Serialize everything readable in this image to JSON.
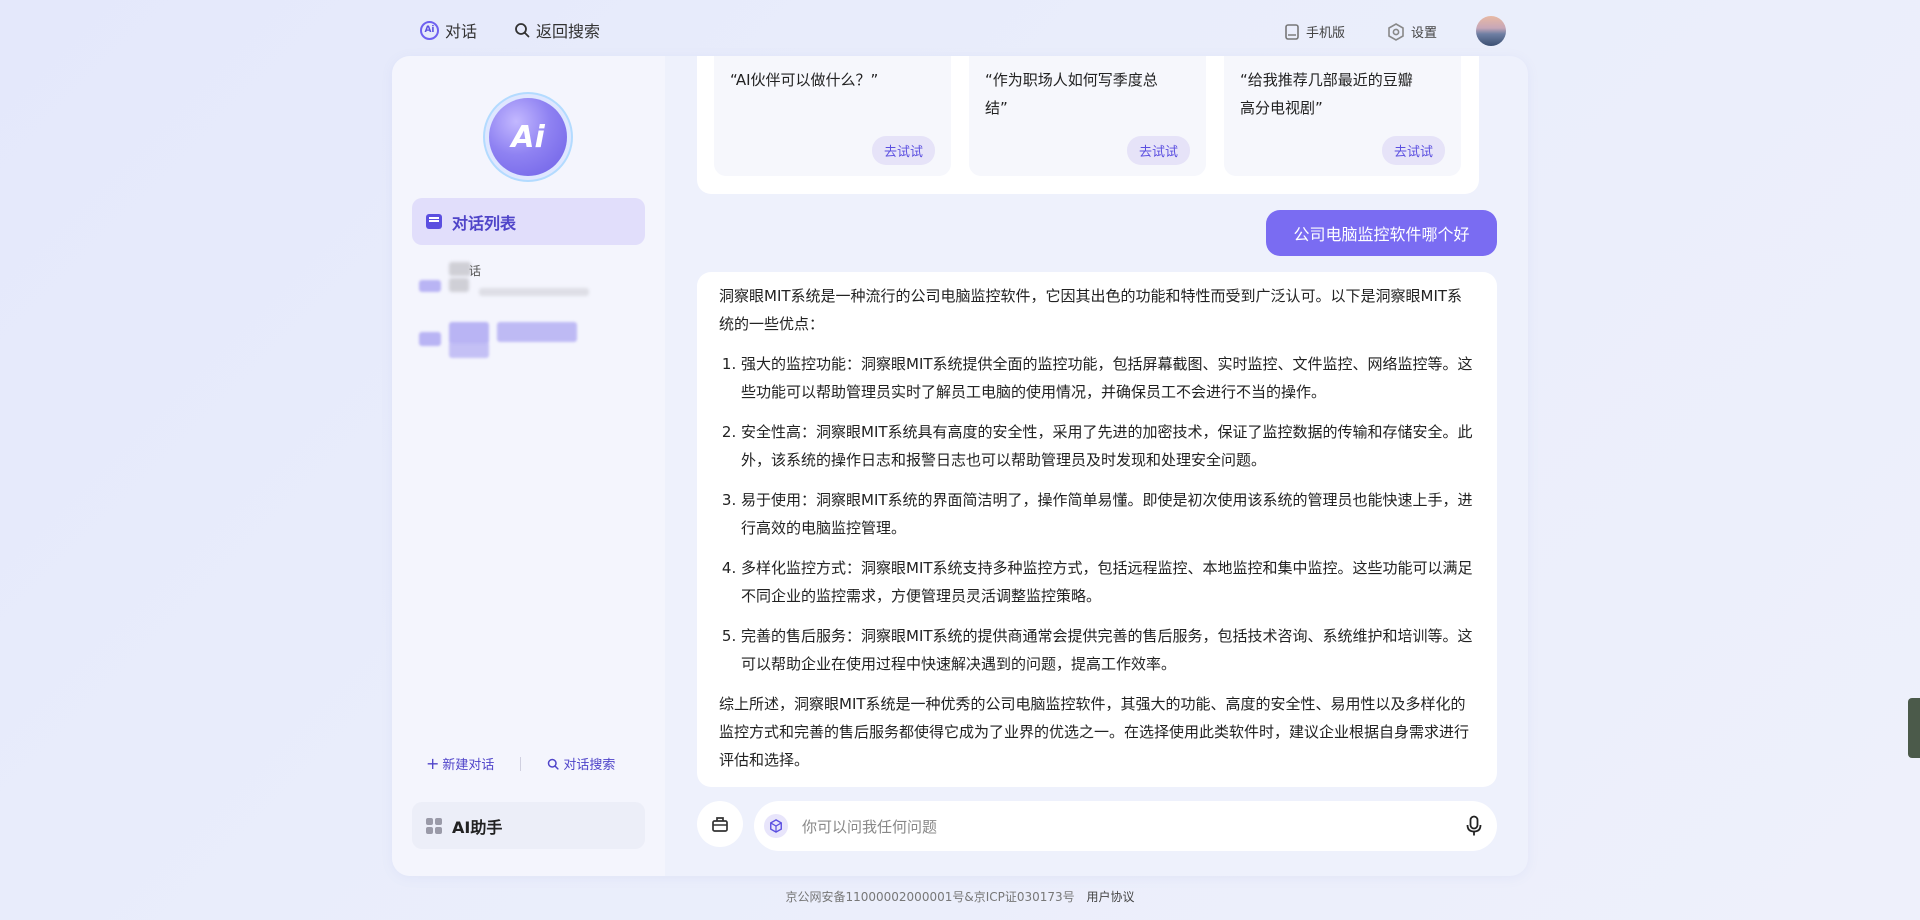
{
  "topbar": {
    "chat_label": "对话",
    "back_search_label": "返回搜索",
    "mobile_label": "手机版",
    "settings_label": "设置"
  },
  "sidebar": {
    "logo_text": "Ai",
    "active_nav_label": "对话列表",
    "history": [
      {
        "label": "话"
      },
      {
        "label": ""
      }
    ],
    "new_chat_label": "新建对话",
    "chat_search_label": "对话搜索",
    "assistant_label": "AI助手"
  },
  "suggestions": [
    {
      "text": "“AI伙伴可以做什么？”",
      "try_label": "去试试"
    },
    {
      "text": "“作为职场人如何写季度总结”",
      "try_label": "去试试"
    },
    {
      "text": "“给我推荐几部最近的豆瓣高分电视剧”",
      "try_label": "去试试"
    }
  ],
  "user_message": "公司电脑监控软件哪个好",
  "answer": {
    "intro": "洞察眼MIT系统是一种流行的公司电脑监控软件，它因其出色的功能和特性而受到广泛认可。以下是洞察眼MIT系统的一些优点：",
    "points": [
      "强大的监控功能：洞察眼MIT系统提供全面的监控功能，包括屏幕截图、实时监控、文件监控、网络监控等。这些功能可以帮助管理员实时了解员工电脑的使用情况，并确保员工不会进行不当的操作。",
      "安全性高：洞察眼MIT系统具有高度的安全性，采用了先进的加密技术，保证了监控数据的传输和存储安全。此外，该系统的操作日志和报警日志也可以帮助管理员及时发现和处理安全问题。",
      "易于使用：洞察眼MIT系统的界面简洁明了，操作简单易懂。即使是初次使用该系统的管理员也能快速上手，进行高效的电脑监控管理。",
      "多样化监控方式：洞察眼MIT系统支持多种监控方式，包括远程监控、本地监控和集中监控。这些功能可以满足不同企业的监控需求，方便管理员灵活调整监控策略。",
      "完善的售后服务：洞察眼MIT系统的提供商通常会提供完善的售后服务，包括技术咨询、系统维护和培训等。这可以帮助企业在使用过程中快速解决遇到的问题，提高工作效率。"
    ],
    "summary": "综上所述，洞察眼MIT系统是一种优秀的公司电脑监控软件，其强大的功能、高度的安全性、易用性以及多样化的监控方式和完善的售后服务都使得它成为了业界的优选之一。在选择使用此类软件时，建议企业根据自身需求进行评估和选择。"
  },
  "input": {
    "placeholder": "你可以问我任何问题"
  },
  "footer": {
    "license": "京公网安备11000002000001号&京ICP证030173号",
    "agreement": "用户协议"
  },
  "icons": {
    "chat": "ai-chat-icon",
    "search": "search-icon",
    "mobile": "mobile-icon",
    "settings": "gear-icon",
    "mic": "microphone-icon"
  },
  "colors": {
    "accent": "#7a6cf2",
    "accent_text": "#4f44c9",
    "background": "#e9edfb"
  }
}
